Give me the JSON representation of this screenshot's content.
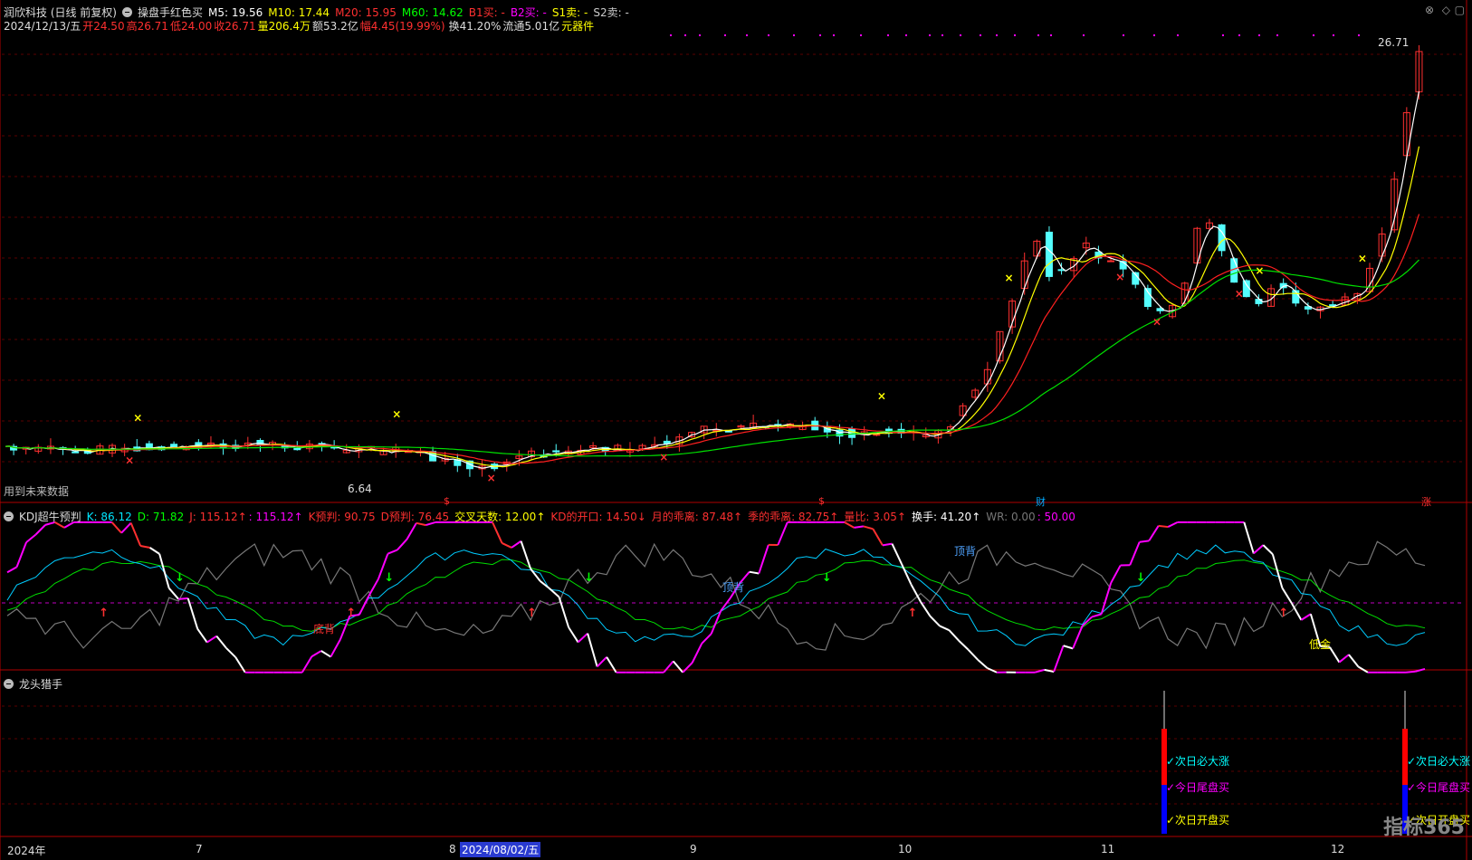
{
  "header": {
    "title": "润欣科技 (日线 前复权)",
    "indicator_name": "操盘手红色买",
    "ma": [
      {
        "label": "M5: 19.56",
        "color": "#ffffff"
      },
      {
        "label": "M10: 17.44",
        "color": "#ffff00"
      },
      {
        "label": "M20: 15.95",
        "color": "#ff3030"
      },
      {
        "label": "M60: 14.62",
        "color": "#00ff00"
      },
      {
        "label": "B1买: -",
        "color": "#ff3030"
      },
      {
        "label": "B2买: -",
        "color": "#ff00ff"
      },
      {
        "label": "S1卖: -",
        "color": "#ffff00"
      },
      {
        "label": "S2卖: -",
        "color": "#cccccc"
      }
    ]
  },
  "quote": [
    {
      "label": "2024/12/13/五",
      "color": "#dddddd"
    },
    {
      "label": "开24.50",
      "color": "#ff3030"
    },
    {
      "label": "高26.71",
      "color": "#ff3030"
    },
    {
      "label": "低24.00",
      "color": "#ff3030"
    },
    {
      "label": "收26.71",
      "color": "#ff3030"
    },
    {
      "label": "量206.4万",
      "color": "#ffff00"
    },
    {
      "label": "额53.2亿",
      "color": "#dddddd"
    },
    {
      "label": "幅4.45(19.99%)",
      "color": "#ff3030"
    },
    {
      "label": "换41.20%",
      "color": "#dddddd"
    },
    {
      "label": "流通5.01亿",
      "color": "#dddddd"
    },
    {
      "label": "元器件",
      "color": "#ffff00"
    }
  ],
  "main_chart": {
    "max_price_label": "26.71",
    "min_price_label": "6.64",
    "future_data_note": "用到未来数据",
    "markers": [
      {
        "label": "$",
        "color": "#ff3030"
      },
      {
        "label": "$",
        "color": "#ff3030"
      },
      {
        "label": "财",
        "color": "#00aaff"
      },
      {
        "label": "涨",
        "color": "#ff3030"
      }
    ]
  },
  "kdj": {
    "name": "KDJ超牛预判",
    "fields": [
      {
        "label": "K: 86.12",
        "color": "#00e5ff"
      },
      {
        "label": "D: 71.82",
        "color": "#00ff00"
      },
      {
        "label": "J: 115.12↑",
        "color": "#ff3030"
      },
      {
        "label": ": 115.12↑",
        "color": "#ff00ff"
      },
      {
        "label": "K预判: 90.75",
        "color": "#ff3030"
      },
      {
        "label": "D预判: 76.45",
        "color": "#ff3030"
      },
      {
        "label": "交叉天数: 12.00↑",
        "color": "#ffff00"
      },
      {
        "label": "KD的开口: 14.50↓",
        "color": "#ff3030"
      },
      {
        "label": "月的乖离: 87.48↑",
        "color": "#ff3030"
      },
      {
        "label": "季的乖离: 82.75↑",
        "color": "#ff3030"
      },
      {
        "label": "量比: 3.05↑",
        "color": "#ff3030"
      },
      {
        "label": "换手: 41.20↑",
        "color": "#ffffff"
      },
      {
        "label": "WR: 0.00",
        "color": "#777777"
      },
      {
        "label": ": 50.00",
        "color": "#ff00ff"
      }
    ],
    "annotations": [
      "顶背",
      "顶背",
      "底背",
      "低金"
    ]
  },
  "dragon": {
    "name": "龙头猎手",
    "signals": [
      "✓次日必大涨",
      "✓今日尾盘买",
      "✓次日开盘买"
    ],
    "signal_colors": [
      "#00ffff",
      "#ff00ff",
      "#ffff00"
    ]
  },
  "time_axis": {
    "labels": [
      "2024年",
      "7",
      "8",
      "2024/08/02/五",
      "9",
      "10",
      "11",
      "12"
    ]
  },
  "logo": "指标365"
}
